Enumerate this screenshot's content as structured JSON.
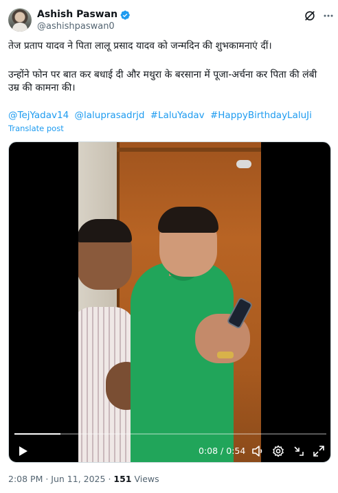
{
  "author": {
    "display_name": "Ashish Paswan",
    "handle": "@ashishpaswan0",
    "verified": true
  },
  "icons": {
    "verified": "verified-badge-icon",
    "grok": "grok-icon",
    "more": "more-options-icon",
    "play": "play-icon",
    "volume": "volume-icon",
    "settings": "settings-gear-icon",
    "minimize": "minimize-player-icon",
    "fullscreen": "fullscreen-icon"
  },
  "tweet": {
    "paragraph1": "तेज प्रताप यादव ने पिता लालू प्रसाद यादव को जन्मदिन की शुभकामनाएं दीं।",
    "paragraph2": "उन्होंने फोन पर बात कर बधाई दी और मथुरा के बरसाना में पूजा-अर्चना कर पिता की लंबी उम्र की कामना की।",
    "mentions": [
      "@TejYadav14",
      "@laluprasadrjd",
      "#LaluYadav",
      "#HappyBirthdayLaluJi"
    ],
    "translate_label": "Translate post"
  },
  "video": {
    "current_time": "0:08",
    "separator": " / ",
    "duration": "0:54",
    "progress": 0.148
  },
  "meta": {
    "time": "2:08 PM",
    "dot1": " · ",
    "date": "Jun 11, 2025",
    "dot2": " · ",
    "views": "151",
    "views_label": " Views"
  },
  "colors": {
    "accent": "#1d9bf0",
    "text": "#0f1419",
    "muted": "#536471"
  }
}
